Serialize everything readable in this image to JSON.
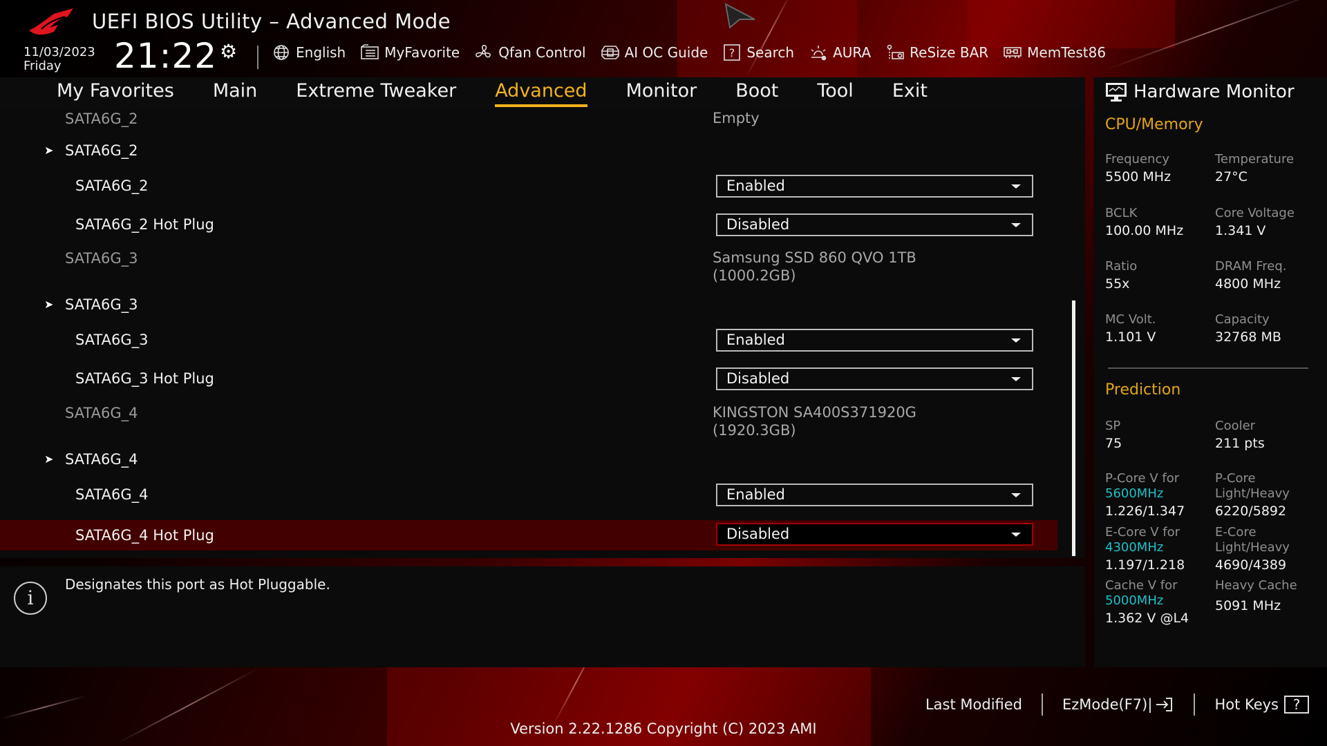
{
  "header": {
    "title": "UEFI BIOS Utility – Advanced Mode",
    "date": "11/03/2023",
    "day": "Friday",
    "time": "21:22",
    "toolbar": [
      {
        "label": "English",
        "icon": "globe-icon"
      },
      {
        "label": "MyFavorite",
        "icon": "favorite-list-icon"
      },
      {
        "label": "Qfan Control",
        "icon": "fan-icon"
      },
      {
        "label": "AI OC Guide",
        "icon": "ai-chip-icon"
      },
      {
        "label": "Search",
        "icon": "question-box-icon"
      },
      {
        "label": "AURA",
        "icon": "aura-light-icon"
      },
      {
        "label": "ReSize BAR",
        "icon": "resize-bar-icon"
      },
      {
        "label": "MemTest86",
        "icon": "memory-icon"
      }
    ]
  },
  "nav": {
    "tabs": [
      "My Favorites",
      "Main",
      "Extreme Tweaker",
      "Advanced",
      "Monitor",
      "Boot",
      "Tool",
      "Exit"
    ],
    "active": "Advanced"
  },
  "content": {
    "rows": [
      {
        "type": "info",
        "label": "SATA6G_2",
        "value": "Empty"
      },
      {
        "type": "submenu",
        "label": "SATA6G_2"
      },
      {
        "type": "option",
        "label": "SATA6G_2",
        "value": "Enabled"
      },
      {
        "type": "option",
        "label": "SATA6G_2 Hot Plug",
        "value": "Disabled"
      },
      {
        "type": "info",
        "label": "SATA6G_3",
        "value": "Samsung SSD 860 QVO 1TB",
        "value2": "(1000.2GB)"
      },
      {
        "type": "submenu",
        "label": "SATA6G_3"
      },
      {
        "type": "option",
        "label": "SATA6G_3",
        "value": "Enabled"
      },
      {
        "type": "option",
        "label": "SATA6G_3 Hot Plug",
        "value": "Disabled"
      },
      {
        "type": "info",
        "label": "SATA6G_4",
        "value": "KINGSTON SA400S371920G",
        "value2": "(1920.3GB)"
      },
      {
        "type": "submenu",
        "label": "SATA6G_4"
      },
      {
        "type": "option",
        "label": "SATA6G_4",
        "value": "Enabled"
      },
      {
        "type": "option",
        "label": "SATA6G_4 Hot Plug",
        "value": "Disabled",
        "selected": true
      }
    ]
  },
  "help": {
    "text": "Designates this port as Hot Pluggable."
  },
  "hardware_monitor": {
    "title": "Hardware Monitor",
    "cpu_memory": {
      "title": "CPU/Memory",
      "items": [
        {
          "label": "Frequency",
          "value": "5500 MHz"
        },
        {
          "label": "Temperature",
          "value": "27°C"
        },
        {
          "label": "BCLK",
          "value": "100.00 MHz"
        },
        {
          "label": "Core Voltage",
          "value": "1.341 V"
        },
        {
          "label": "Ratio",
          "value": "55x"
        },
        {
          "label": "DRAM Freq.",
          "value": "4800 MHz"
        },
        {
          "label": "MC Volt.",
          "value": "1.101 V"
        },
        {
          "label": "Capacity",
          "value": "32768 MB"
        }
      ]
    },
    "prediction": {
      "title": "Prediction",
      "sp_label": "SP",
      "sp_value": "75",
      "cooler_label": "Cooler",
      "cooler_value": "211 pts",
      "pcore_v_label": "P-Core V for",
      "pcore_v_freq": "5600MHz",
      "pcore_v_value": "1.226/1.347",
      "pcore_lh_label1": "P-Core",
      "pcore_lh_label2": "Light/Heavy",
      "pcore_lh_value": "6220/5892",
      "ecore_v_label": "E-Core V for",
      "ecore_v_freq": "4300MHz",
      "ecore_v_value": "1.197/1.218",
      "ecore_lh_label1": "E-Core",
      "ecore_lh_label2": "Light/Heavy",
      "ecore_lh_value": "4690/4389",
      "cache_v_label": "Cache V for",
      "cache_v_freq": "5000MHz",
      "cache_v_value": "1.362 V @L4",
      "heavy_cache_label": "Heavy Cache",
      "heavy_cache_value": "5091 MHz"
    }
  },
  "footer": {
    "last_modified": "Last Modified",
    "ezmode": "EzMode(F7)|",
    "hot_keys": "Hot Keys",
    "hot_keys_icon": "?",
    "version": "Version 2.22.1286 Copyright (C) 2023 AMI"
  },
  "colors": {
    "accent": "#f2b21c",
    "highlight_row": "#430000",
    "prediction_freq": "#1fc0c8"
  }
}
